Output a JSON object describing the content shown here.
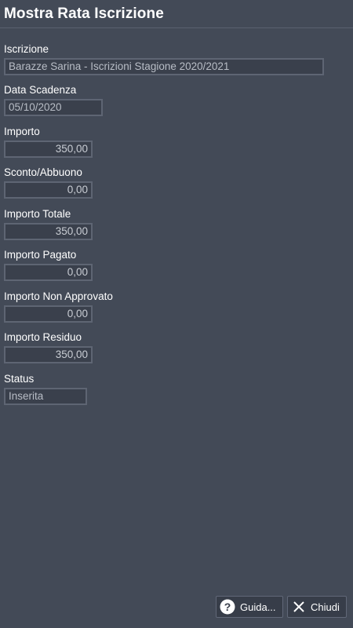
{
  "window": {
    "title": "Mostra Rata Iscrizione"
  },
  "fields": {
    "iscrizione": {
      "label": "Iscrizione",
      "value": "Barazze Sarina - Iscrizioni Stagione 2020/2021"
    },
    "data_scadenza": {
      "label": "Data Scadenza",
      "value": "05/10/2020"
    },
    "importo": {
      "label": "Importo",
      "value": "350,00"
    },
    "sconto": {
      "label": "Sconto/Abbuono",
      "value": "0,00"
    },
    "importo_totale": {
      "label": "Importo Totale",
      "value": "350,00"
    },
    "importo_pagato": {
      "label": "Importo Pagato",
      "value": "0,00"
    },
    "importo_non_approvato": {
      "label": "Importo Non Approvato",
      "value": "0,00"
    },
    "importo_residuo": {
      "label": "Importo Residuo",
      "value": "350,00"
    },
    "status": {
      "label": "Status",
      "value": "Inserita"
    }
  },
  "buttons": {
    "help_label": "Guida...",
    "help_icon": "question-circle-icon",
    "close_label": "Chiudi",
    "close_icon": "close-x-icon"
  },
  "colors": {
    "background": "#434a57",
    "input_background": "#3a404c",
    "input_border": "#5e6573"
  }
}
